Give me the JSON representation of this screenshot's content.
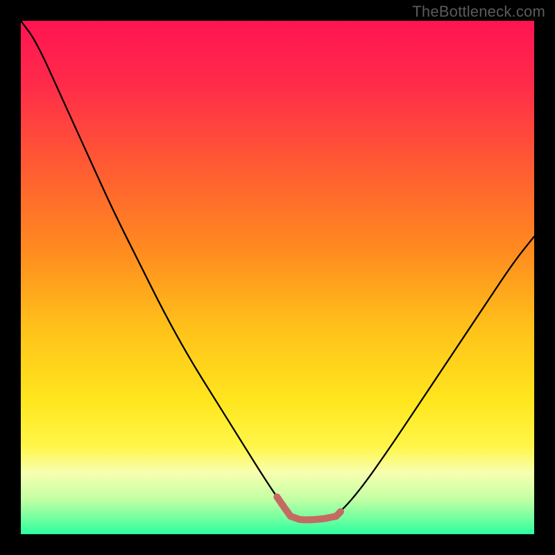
{
  "watermark": "TheBottleneck.com",
  "colors": {
    "frame": "#000000",
    "watermark": "#5b5b5b",
    "curve": "#000000",
    "bottom_highlight": "#c46a62",
    "gradient_stops": [
      {
        "offset": 0.0,
        "color": "#ff1452"
      },
      {
        "offset": 0.12,
        "color": "#ff2a4a"
      },
      {
        "offset": 0.28,
        "color": "#ff5a33"
      },
      {
        "offset": 0.45,
        "color": "#ff8c1f"
      },
      {
        "offset": 0.6,
        "color": "#ffc21a"
      },
      {
        "offset": 0.74,
        "color": "#ffe61e"
      },
      {
        "offset": 0.83,
        "color": "#fff64a"
      },
      {
        "offset": 0.88,
        "color": "#f7ffb0"
      },
      {
        "offset": 0.93,
        "color": "#c6ffa5"
      },
      {
        "offset": 0.965,
        "color": "#7cffa0"
      },
      {
        "offset": 1.0,
        "color": "#2bff9f"
      }
    ]
  },
  "chart_data": {
    "type": "line",
    "title": "",
    "xlabel": "",
    "ylabel": "",
    "xlim": [
      0,
      1
    ],
    "ylim": [
      0,
      1
    ],
    "series": [
      {
        "name": "bottleneck-curve",
        "x": [
          0.0,
          0.03,
          0.08,
          0.13,
          0.18,
          0.23,
          0.28,
          0.33,
          0.38,
          0.43,
          0.48,
          0.525,
          0.545,
          0.565,
          0.59,
          0.615,
          0.66,
          0.72,
          0.78,
          0.84,
          0.9,
          0.96,
          1.0
        ],
        "y": [
          1.0,
          0.96,
          0.85,
          0.74,
          0.63,
          0.53,
          0.43,
          0.34,
          0.26,
          0.18,
          0.1,
          0.035,
          0.028,
          0.028,
          0.03,
          0.035,
          0.085,
          0.17,
          0.26,
          0.35,
          0.44,
          0.53,
          0.58
        ]
      }
    ],
    "highlight": {
      "x_range": [
        0.499,
        0.623
      ],
      "y": 0.03
    }
  }
}
